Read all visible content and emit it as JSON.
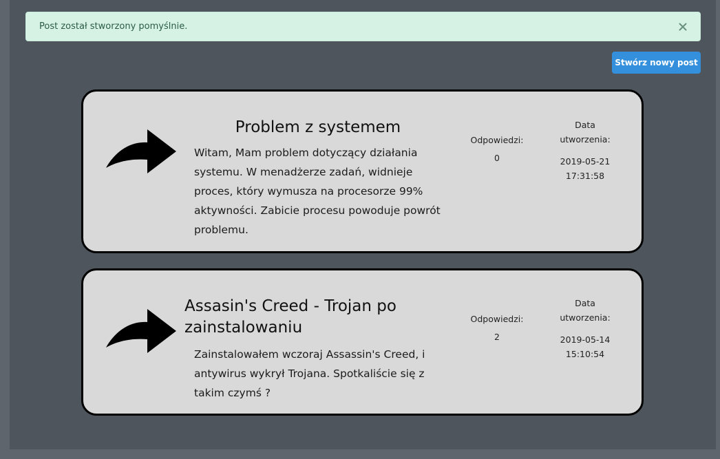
{
  "alert": {
    "message": "Post został stworzony pomyślnie.",
    "close_icon": "close-icon"
  },
  "toolbar": {
    "new_post_label": "Stwórz nowy post"
  },
  "posts": [
    {
      "title": "Problem z systemem",
      "body": "Witam, Mam problem dotyczący działania systemu. W menadżerze zadań, widnieje proces, który wymusza na procesorze 99% aktywności. Zabicie procesu powoduje powrót problemu.",
      "replies_label": "Odpowiedzi:",
      "replies_count": "0",
      "created_label": "Data utworzenia:",
      "created_at": "2019-05-21 17:31:58",
      "icon": "share-arrow-icon"
    },
    {
      "title": "Assasin's Creed - Trojan po zainstalowaniu",
      "body": "Zainstalowałem wczoraj Assassin's Creed, i antywirus wykrył Trojana. Spotkaliście się z takim czymś ?",
      "replies_label": "Odpowiedzi:",
      "replies_count": "2",
      "created_label": "Data utworzenia:",
      "created_at": "2019-05-14 15:10:54",
      "icon": "share-arrow-icon"
    }
  ],
  "colors": {
    "page_bg": "#5f656c",
    "panel_bg": "#4f555c",
    "alert_bg": "#d5f2e5",
    "alert_text": "#2d5c45",
    "button_bg": "#3490dc",
    "card_bg": "#d9d9d9",
    "card_border": "#000000"
  }
}
